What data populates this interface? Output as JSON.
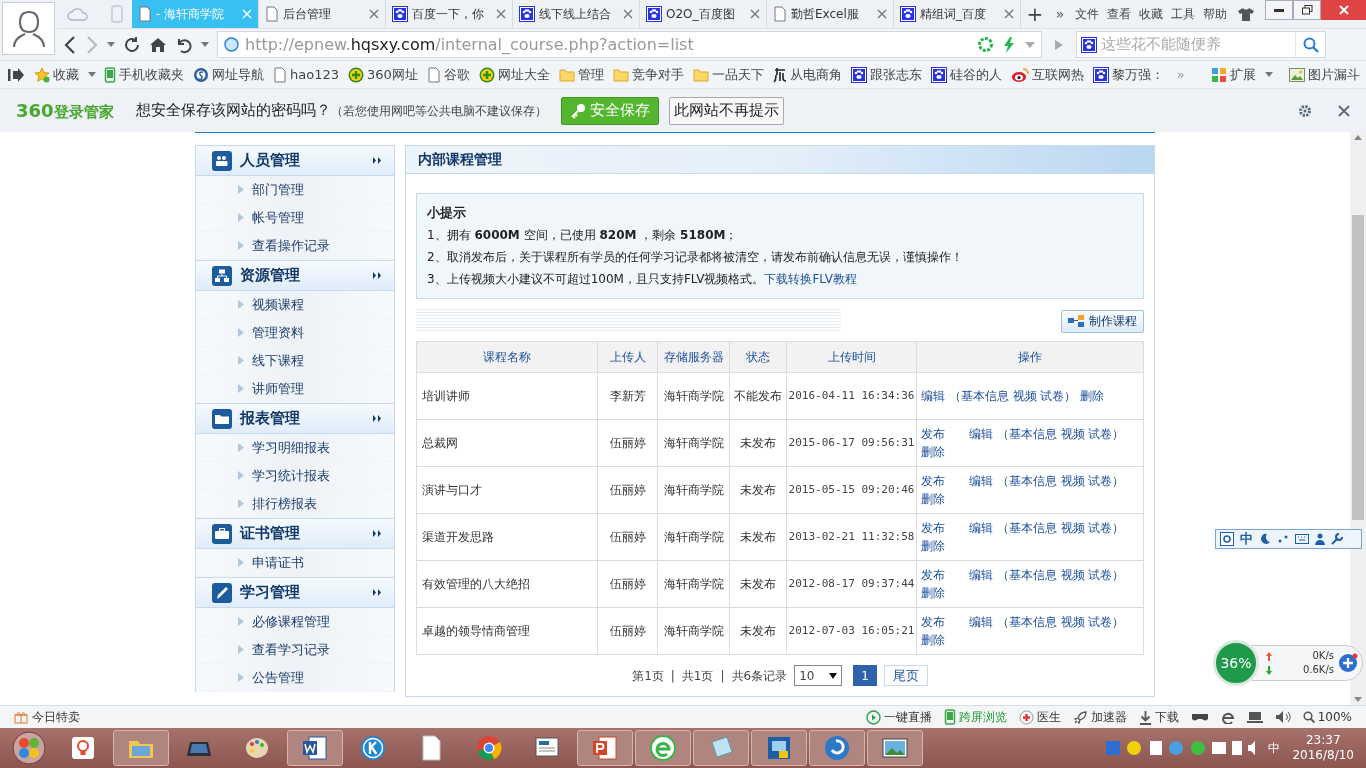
{
  "browser": {
    "tabs": [
      {
        "title": "- 海轩商学院",
        "kind": "page",
        "selected": true
      },
      {
        "title": "后台管理",
        "kind": "page",
        "selected": false
      },
      {
        "title": "百度一下，你",
        "kind": "paw",
        "selected": false
      },
      {
        "title": "线下线上结合",
        "kind": "paw",
        "selected": false
      },
      {
        "title": "O2O_百度图",
        "kind": "paw",
        "selected": false
      },
      {
        "title": "勤哲Excel服",
        "kind": "page",
        "selected": false
      },
      {
        "title": "精组词_百度",
        "kind": "paw",
        "selected": false
      }
    ],
    "new_tab": "+",
    "more_tabs": "»",
    "menu": [
      "文件",
      "查看",
      "收藏",
      "工具",
      "帮助"
    ],
    "url": {
      "scheme": "http://epnew.",
      "host": "hqsxy.com",
      "path": "/internal_course.php?action=list"
    },
    "search": {
      "placeholder": "这些花不能随便养"
    },
    "bookmarks": [
      {
        "label": "收藏",
        "kind": "star"
      },
      {
        "label": "手机收藏夹",
        "kind": "phone"
      },
      {
        "label": "网址导航",
        "kind": "circle"
      },
      {
        "label": "hao123",
        "kind": "page"
      },
      {
        "label": "360网址",
        "kind": "plus"
      },
      {
        "label": "谷歌",
        "kind": "page"
      },
      {
        "label": "网址大全",
        "kind": "plus"
      },
      {
        "label": "管理",
        "kind": "folder"
      },
      {
        "label": "竞争对手",
        "kind": "folder"
      },
      {
        "label": "一品天下",
        "kind": "folder"
      },
      {
        "label": "从电商角",
        "kind": "brush"
      },
      {
        "label": "跟张志东",
        "kind": "paw"
      },
      {
        "label": "硅谷的人",
        "kind": "paw"
      },
      {
        "label": "互联网热",
        "kind": "eye"
      },
      {
        "label": "黎万强：",
        "kind": "paw"
      }
    ],
    "bookmarks_more": "»",
    "extensions": [
      {
        "label": "扩展",
        "kind": "grid"
      },
      {
        "label": "图片漏斗",
        "kind": "picture"
      }
    ]
  },
  "password_bar": {
    "logo_number": "360",
    "logo_text": "登录管家",
    "question": "想安全保存该网站的密码吗？",
    "note": "（若您使用网吧等公共电脑不建议保存）",
    "save": "安全保存",
    "never": "此网站不再提示"
  },
  "sidebar": [
    {
      "title": "人员管理",
      "kind": "people",
      "items": [
        "部门管理",
        "帐号管理",
        "查看操作记录"
      ]
    },
    {
      "title": "资源管理",
      "kind": "network",
      "items": [
        "视频课程",
        "管理资料",
        "线下课程",
        "讲师管理"
      ]
    },
    {
      "title": "报表管理",
      "kind": "folder",
      "items": [
        "学习明细报表",
        "学习统计报表",
        "排行榜报表"
      ]
    },
    {
      "title": "证书管理",
      "kind": "briefcase",
      "items": [
        "申请证书"
      ]
    },
    {
      "title": "学习管理",
      "kind": "pen",
      "items": [
        "必修课程管理",
        "查看学习记录",
        "公告管理"
      ]
    }
  ],
  "main": {
    "title": "内部课程管理",
    "tips": {
      "title": "小提示",
      "lines": [
        "1、拥有 **6000M** 空间，已使用 **820M** ，剩余 **5180M**；",
        "2、取消发布后，关于课程所有学员的任何学习记录都将被清空，请发布前确认信息无误，谨慎操作！",
        "3、上传视频大小建议不可超过100M，且只支持FLV视频格式。"
      ],
      "link": "下载转换FLV教程"
    },
    "create_button": "制作课程",
    "table": {
      "columns": [
        "课程名称",
        "上传人",
        "存储服务器",
        "状态",
        "上传时间",
        "操作"
      ],
      "rows": [
        {
          "name": "培训讲师",
          "uploader": "李新芳",
          "server": "海轩商学院",
          "status": "不能发布",
          "time": "2016-04-11 16:34:36",
          "actions": [
            "编辑",
            "（基本信息",
            "视频",
            "试卷）",
            "删除"
          ]
        },
        {
          "name": "总裁网",
          "uploader": "伍丽婷",
          "server": "海轩商学院",
          "status": "未发布",
          "time": "2015-06-17 09:56:31",
          "actions": [
            "发布",
            "编辑",
            "（基本信息",
            "视频",
            "试卷）",
            "删除"
          ]
        },
        {
          "name": "演讲与口才",
          "uploader": "伍丽婷",
          "server": "海轩商学院",
          "status": "未发布",
          "time": "2015-05-15 09:20:46",
          "actions": [
            "发布",
            "编辑",
            "（基本信息",
            "视频",
            "试卷）",
            "删除"
          ]
        },
        {
          "name": "渠道开发思路",
          "uploader": "伍丽婷",
          "server": "海轩商学院",
          "status": "未发布",
          "time": "2013-02-21 11:32:58",
          "actions": [
            "发布",
            "编辑",
            "（基本信息",
            "视频",
            "试卷）",
            "删除"
          ]
        },
        {
          "name": "有效管理的八大绝招",
          "uploader": "伍丽婷",
          "server": "海轩商学院",
          "status": "未发布",
          "time": "2012-08-17 09:37:44",
          "actions": [
            "发布",
            "编辑",
            "（基本信息",
            "视频",
            "试卷）",
            "删除"
          ]
        },
        {
          "name": "卓越的领导情商管理",
          "uploader": "伍丽婷",
          "server": "海轩商学院",
          "status": "未发布",
          "time": "2012-07-03 16:05:21",
          "actions": [
            "发布",
            "编辑",
            "（基本信息",
            "视频",
            "试卷）",
            "删除"
          ]
        }
      ]
    },
    "pagination": {
      "info": [
        "第1页",
        "|",
        "共1页",
        "|",
        "共6条记录"
      ],
      "page_size": "10",
      "pages": [
        {
          "label": "1",
          "selected": true
        }
      ],
      "last": "尾页"
    }
  },
  "ime_bar": {
    "label": "中"
  },
  "speed_widget": {
    "percent": "36%",
    "up": "0K/s",
    "down": "0.6K/s"
  },
  "status_bar": {
    "left": "今日特卖",
    "items": [
      {
        "label": "一键直播",
        "kind": "play",
        "highlighted": false
      },
      {
        "label": "跨屏浏览",
        "kind": "phone",
        "highlighted": true
      },
      {
        "label": "医生",
        "kind": "doctor",
        "highlighted": false
      },
      {
        "label": "加速器",
        "kind": "rocket",
        "highlighted": false
      },
      {
        "label": "下载",
        "kind": "download",
        "highlighted": false
      }
    ],
    "zoom": "100%"
  },
  "taskbar": {
    "apps": [
      {
        "kind": "bulb",
        "open": false
      },
      {
        "kind": "explorer",
        "open": true
      },
      {
        "kind": "laptop",
        "open": false
      },
      {
        "kind": "palette",
        "open": false
      },
      {
        "kind": "word",
        "open": true
      },
      {
        "kind": "k",
        "open": false
      },
      {
        "kind": "doc",
        "open": false
      },
      {
        "kind": "chrome",
        "open": false
      },
      {
        "kind": "monitor",
        "open": false
      },
      {
        "kind": "ppt",
        "open": true
      },
      {
        "kind": "browser",
        "open": true
      },
      {
        "kind": "notepad",
        "open": true
      },
      {
        "kind": "film",
        "open": true
      },
      {
        "kind": "swirl",
        "open": true
      },
      {
        "kind": "image",
        "open": true
      }
    ],
    "ime": "中",
    "time": "23:37",
    "date": "2016/8/10"
  }
}
